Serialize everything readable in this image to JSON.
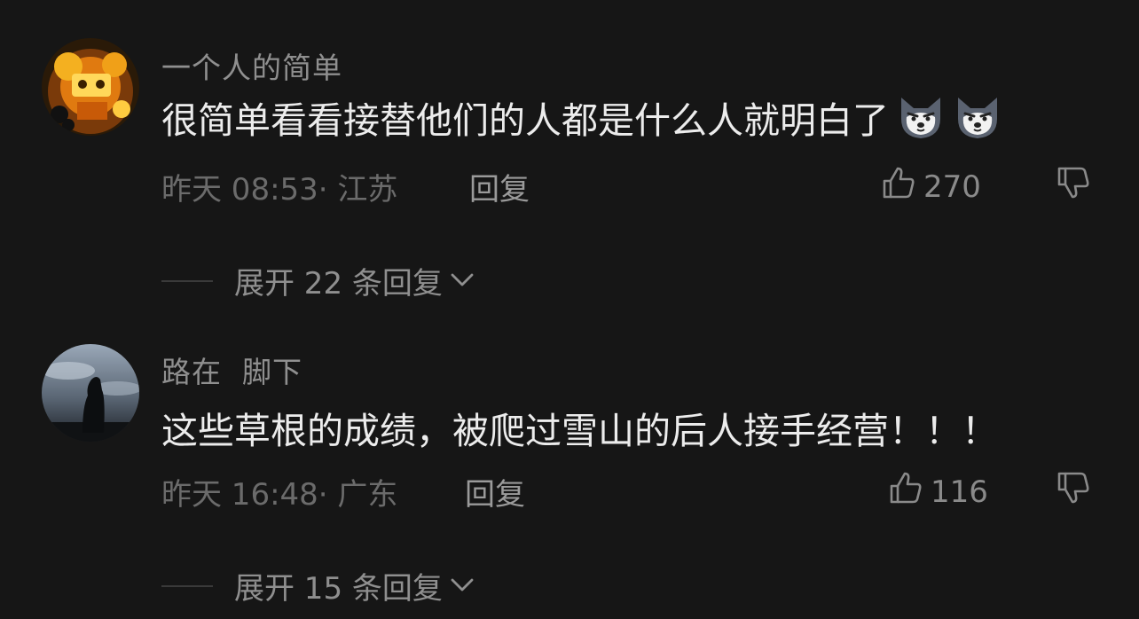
{
  "comments": [
    {
      "username": "一个人的简单",
      "content": "很简单看看接替他们的人都是什么人就明白了",
      "emojis": [
        "husky-emoji",
        "husky-emoji"
      ],
      "time_location": "昨天 08:53· 江苏",
      "reply_label": "回复",
      "likes": "270",
      "expand_label": "展开 22 条回复"
    },
    {
      "username": "路在  脚下",
      "content": "这些草根的成绩，被爬过雪山的后人接手经营！！！",
      "emojis": [],
      "time_location": "昨天 16:48· 广东",
      "reply_label": "回复",
      "likes": "116",
      "expand_label": "展开 15 条回复"
    }
  ],
  "colors": {
    "background": "#161616",
    "username": "#8f8f8f",
    "content": "#ececec",
    "meta": "#6b6b6b"
  },
  "icons": {
    "like": "thumbs-up-icon",
    "dislike": "thumbs-down-icon",
    "expand": "chevron-down-icon"
  }
}
